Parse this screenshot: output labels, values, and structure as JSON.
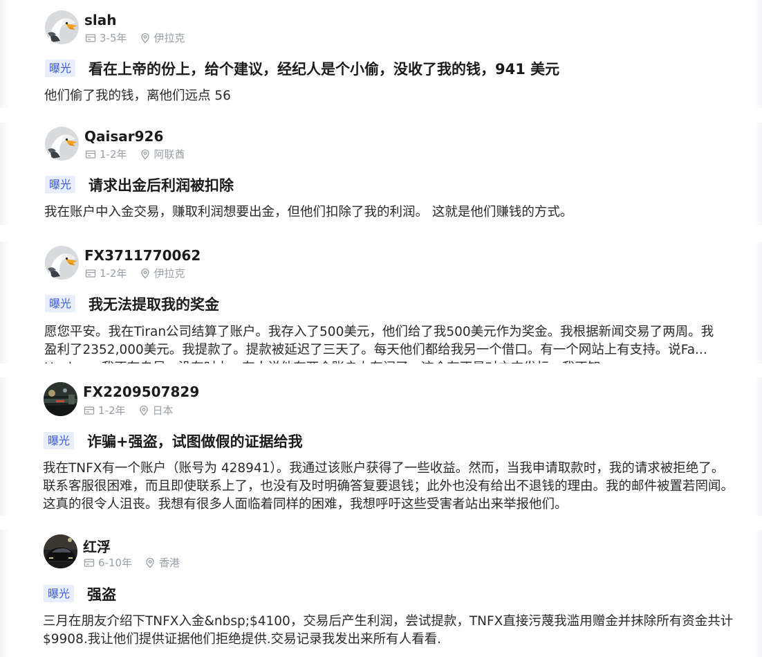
{
  "posts": [
    {
      "username": "slah",
      "experience": "3-5年",
      "location": "伊拉克",
      "tag": "曝光",
      "title": "看在上帝的份上，给个建议，经纪人是个小偷，没收了我的钱，941 美元",
      "body": "他们偷了我的钱，离他们远点 56",
      "avatar": "eagle-avatar"
    },
    {
      "username": "Qaisar926",
      "experience": "1-2年",
      "location": "阿联酋",
      "tag": "曝光",
      "title": "请求出金后利润被扣除",
      "body": "我在账户中入金交易，赚取利润想要出金，但他们扣除了我的利润。 这就是他们赚钱的方式。",
      "avatar": "eagle-avatar"
    },
    {
      "username": "FX3711770062",
      "experience": "1-2年",
      "location": "伊拉克",
      "tag": "曝光",
      "title": "我无法提取我的奖金",
      "body": "愿您平安。我在Tiran公司结算了账户。我存入了500美元，他们给了我500美元作为奖金。我根据新闻交易了两周。我盈利了2352,000美元。我提款了。提款被延迟了三天了。每天他们都给我另一个借口。有一个网站上有支持。说Fa... Hesh...。我不存自尽，没有时力，有人说他有两个账户上有问了。这个有不是对之支发标。我不知",
      "avatar": "eagle-avatar"
    },
    {
      "username": "FX2209507829",
      "experience": "1-2年",
      "location": "日本",
      "tag": "曝光",
      "title": "诈骗+强盗，试图做假的证据给我",
      "body": "我在TNFX有一个账户（账号为 428941）。我通过该账户获得了一些收益。然而，当我申请取款时，我的请求被拒绝了。联系客服很困难，而且即使联系上了，也没有及时明确答复要退钱；此外也没有给出不退钱的理由。我的邮件被置若罔闻。这真的很令人沮丧。我想有很多人面临着同样的困难，我想呼吁这些受害者站出来举报他们。",
      "avatar": "night-street-photo"
    },
    {
      "username": "红浮",
      "experience": "6-10年",
      "location": "香港",
      "tag": "曝光",
      "title": "强盗",
      "body": "三月在朋友介绍下TNFX入金&nbsp;$4100，交易后产生利润，尝试提款，TNFX直接污蔑我滥用赠金并抹除所有资金共计$9908.我让他们提供证据他们拒绝提供.交易记录我发出来所有人看看.",
      "avatar": "car-photo"
    }
  ],
  "colors": {
    "tag_text": "#3f5be6",
    "tag_bg": "#e9eeff",
    "meta_text": "#9a9ea6",
    "title_text": "#1b1b1b"
  }
}
